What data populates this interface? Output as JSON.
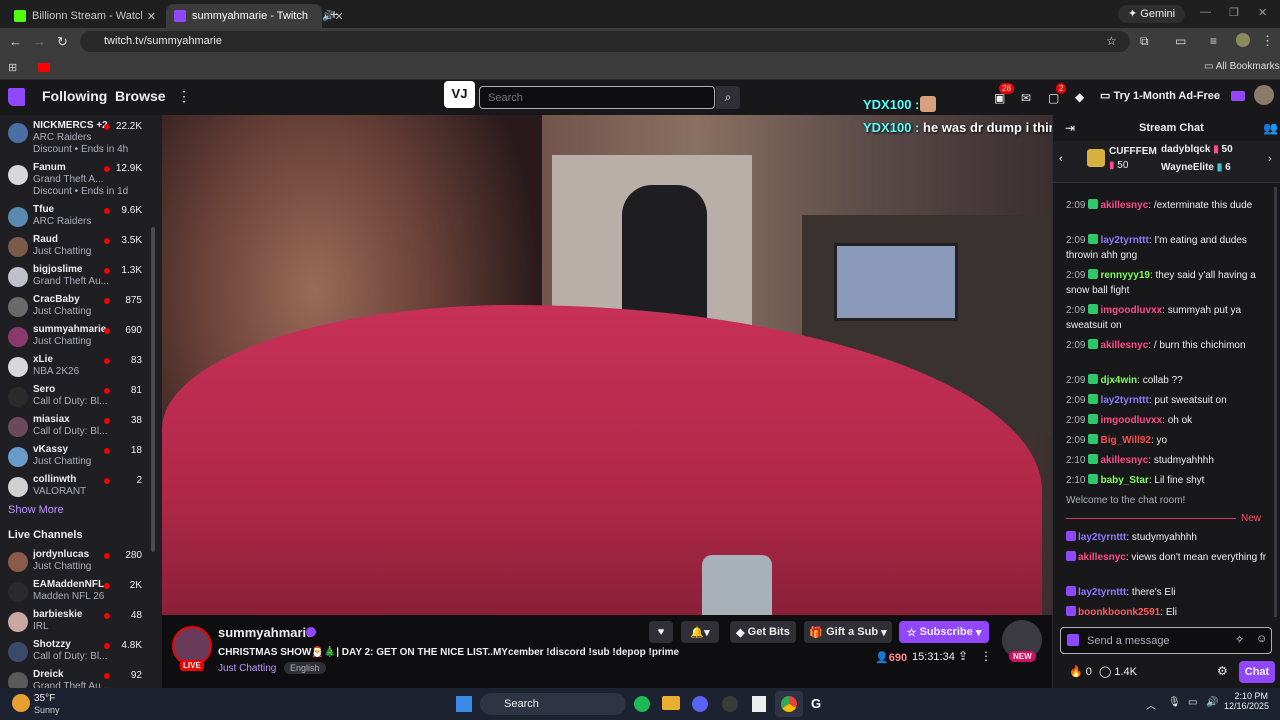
{
  "browser": {
    "tabs": [
      {
        "title": "Billionn Stream - Watch Live on",
        "active": false
      },
      {
        "title": "summyahmarie - Twitch",
        "active": true
      }
    ],
    "gemini_label": "Gemini",
    "url": "twitch.tv/summyahmarie",
    "all_bookmarks": "All Bookmarks"
  },
  "topnav": {
    "following": "Following",
    "browse": "Browse",
    "search_placeholder": "Search",
    "notif_count": "28",
    "whisper_count": "2",
    "ad_free": "Try 1-Month Ad-Free"
  },
  "overlay": {
    "line1_user": "YDX100 :",
    "line2_user": "YDX100 :",
    "line2_text": "he was dr dump i think"
  },
  "sidebar": {
    "followed": [
      {
        "name": "NICKMERCS +2",
        "game": "ARC Raiders",
        "viewers": "22.2K",
        "discount": "Discount • Ends in 4h",
        "color": "#4a6fa5"
      },
      {
        "name": "Fanum",
        "game": "Grand Theft A...",
        "viewers": "12.9K",
        "discount": "Discount • Ends in 1d",
        "color": "#d8d8d8"
      },
      {
        "name": "Tfue",
        "game": "ARC Raiders",
        "viewers": "9.6K",
        "color": "#5a8ab0"
      },
      {
        "name": "Raud",
        "game": "Just Chatting",
        "viewers": "3.5K",
        "color": "#7a5a4a"
      },
      {
        "name": "bigjoslime",
        "game": "Grand Theft Au...",
        "viewers": "1.3K",
        "color": "#c0c0c8"
      },
      {
        "name": "CracBaby",
        "game": "Just Chatting",
        "viewers": "875",
        "color": "#6a6a6a"
      },
      {
        "name": "summyahmarie",
        "game": "Just Chatting",
        "viewers": "690",
        "color": "#8a3a6a"
      },
      {
        "name": "xLie",
        "game": "NBA 2K26",
        "viewers": "83",
        "color": "#d8d8d8"
      },
      {
        "name": "Sero",
        "game": "Call of Duty: Bl...",
        "viewers": "81",
        "color": "#2a2a2a"
      },
      {
        "name": "miasiax",
        "game": "Call of Duty: Bl...",
        "viewers": "38",
        "color": "#6a4a5a"
      },
      {
        "name": "vKassy",
        "game": "Just Chatting",
        "viewers": "18",
        "color": "#6a9ac8"
      },
      {
        "name": "collinwth",
        "game": "VALORANT",
        "viewers": "2",
        "color": "#d0d0d0"
      }
    ],
    "show_more": "Show More",
    "live_channels_header": "Live Channels",
    "live": [
      {
        "name": "jordynlucas",
        "game": "Just Chatting",
        "viewers": "280",
        "color": "#8a5a4a"
      },
      {
        "name": "EAMaddenNFL",
        "game": "Madden NFL 26",
        "viewers": "2K",
        "color": "#2a2a2a"
      },
      {
        "name": "barbieskie",
        "game": "IRL",
        "viewers": "48",
        "color": "#c8a8a0"
      },
      {
        "name": "Shotzzy",
        "game": "Call of Duty: Bl...",
        "viewers": "4.8K",
        "color": "#3a4a6a"
      },
      {
        "name": "Dreick",
        "game": "Grand Theft Au...",
        "viewers": "92",
        "color": "#5a5a5a"
      }
    ]
  },
  "stream": {
    "channel": "summyahmarie",
    "live_badge": "LIVE",
    "title": "CHRISTMAS SHOW🎅🎄| DAY 2: GET ON THE NICE LIST..MYcember !discord !sub !depop !prime",
    "category": "Just Chatting",
    "tag": "English",
    "viewers": "690",
    "uptime": "15:31:34",
    "get_bits": "Get Bits",
    "gift_sub": "Gift a Sub",
    "subscribe": "Subscribe",
    "new_badge": "NEW"
  },
  "chat": {
    "header": "Stream Chat",
    "gifters": [
      {
        "name": "CUFFFEM",
        "count": "50"
      },
      {
        "name": "dadyblqck",
        "count": "50"
      },
      {
        "name": "WayneElite",
        "count": "6"
      }
    ],
    "messages": [
      {
        "time": "2:09",
        "user": "akillesnyc",
        "color": "#ff4a8a",
        "text": "/exterminate this dude"
      },
      {
        "time": "2:09",
        "user": "lay2tyrnttt",
        "color": "#8a7aff",
        "text": "I'm eating and dudes throwin ahh gng"
      },
      {
        "time": "2:09",
        "user": "rennyyy19",
        "color": "#7aff5a",
        "text": "they said y'all having a snow ball fight"
      },
      {
        "time": "2:09",
        "user": "imgoodluvxx",
        "color": "#ff4a8a",
        "text": "summyah put ya sweatsuit on"
      },
      {
        "time": "2:09",
        "user": "akillesnyc",
        "color": "#ff4a8a",
        "text": "/ burn this chichimon"
      },
      {
        "time": "2:09",
        "user": "djx4win",
        "color": "#7aff5a",
        "text": "collab ??"
      },
      {
        "time": "2:09",
        "user": "lay2tyrnttt",
        "color": "#8a7aff",
        "text": "put sweatsuit on"
      },
      {
        "time": "2:09",
        "user": "imgoodluvxx",
        "color": "#ff4a8a",
        "text": "oh ok"
      },
      {
        "time": "2:09",
        "user": "Big_Will92",
        "color": "#ff4a4a",
        "text": "yo"
      },
      {
        "time": "2:10",
        "user": "akillesnyc",
        "color": "#ff4a8a",
        "text": "studmyahhhh"
      },
      {
        "time": "2:10",
        "user": "baby_Star",
        "color": "#7aff5a",
        "text": "Lil fine shyt"
      }
    ],
    "welcome": "Welcome to the chat room!",
    "new_label": "New",
    "new_messages": [
      {
        "user": "lay2tyrnttt",
        "color": "#8a7aff",
        "text": "studymyahhhh"
      },
      {
        "user": "akillesnyc",
        "color": "#ff4a8a",
        "text": "views don't mean everything fr"
      },
      {
        "user": "lay2tyrnttt",
        "color": "#8a7aff",
        "text": "there's Eli"
      },
      {
        "user": "boonkboonk2591",
        "color": "#ff5a5a",
        "text": "Eli"
      }
    ],
    "input_placeholder": "Send a message",
    "bits": "0",
    "points": "1.4K",
    "chat_button": "Chat"
  },
  "taskbar": {
    "weather_temp": "35°F",
    "weather_desc": "Sunny",
    "search": "Search",
    "time": "2:10 PM",
    "date": "12/16/2025"
  }
}
